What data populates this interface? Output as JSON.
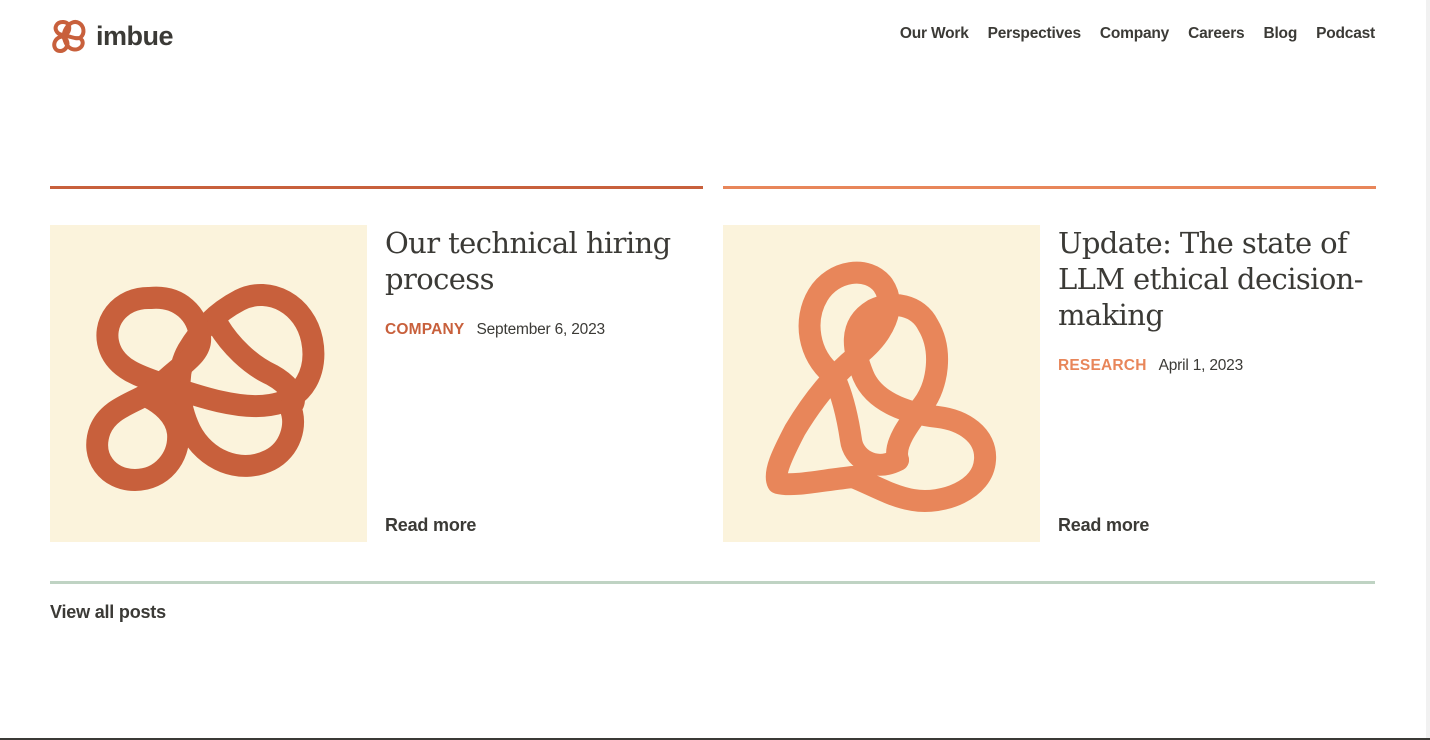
{
  "brand": {
    "name": "imbue",
    "color": "#c8603c"
  },
  "nav": {
    "items": [
      {
        "label": "Our Work"
      },
      {
        "label": "Perspectives"
      },
      {
        "label": "Company"
      },
      {
        "label": "Careers"
      },
      {
        "label": "Blog"
      },
      {
        "label": "Podcast"
      }
    ]
  },
  "posts": [
    {
      "title": "Our technical hiring process",
      "category": "COMPANY",
      "date": "September 6, 2023",
      "read_more": "Read more",
      "accent": "#c8603c",
      "thumb_bg": "#fbf3dc",
      "thumb_icon": "knot-illustration-icon"
    },
    {
      "title": "Update: The state of LLM ethical decision-making",
      "category": "RESEARCH",
      "date": "April 1, 2023",
      "read_more": "Read more",
      "accent": "#e8865a",
      "thumb_bg": "#fbf3dc",
      "thumb_icon": "loop-illustration-icon"
    }
  ],
  "footer": {
    "view_all": "View all posts",
    "rule_color": "#bfd3c3"
  }
}
